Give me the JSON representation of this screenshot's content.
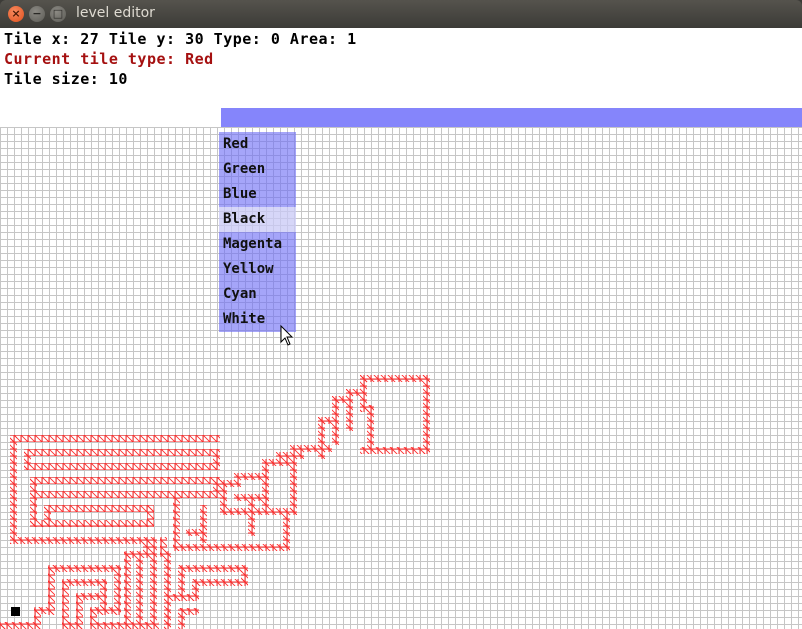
{
  "window": {
    "title": "level editor",
    "buttons": {
      "close": "×",
      "minimize": "−",
      "maximize": "□"
    }
  },
  "hud": {
    "line1": "Tile x: 27 Tile y: 30 Type: 0 Area: 1",
    "line2": "Current tile type: Red",
    "line3": "Tile size: 10"
  },
  "menu": {
    "items": [
      "Red",
      "Green",
      "Blue",
      "Black",
      "Magenta",
      "Yellow",
      "Cyan",
      "White"
    ],
    "hovered": "Black"
  },
  "colors": {
    "tile_red": "#ff2a2a",
    "grid_line": "#c6c6c6",
    "menu_bg": "#6e6ef5",
    "menu_hover": "#c8c8f5",
    "top_bar": "#8585fb",
    "hud_red": "#a51010"
  },
  "icons": {
    "cursor": "arrow-cursor-icon"
  }
}
